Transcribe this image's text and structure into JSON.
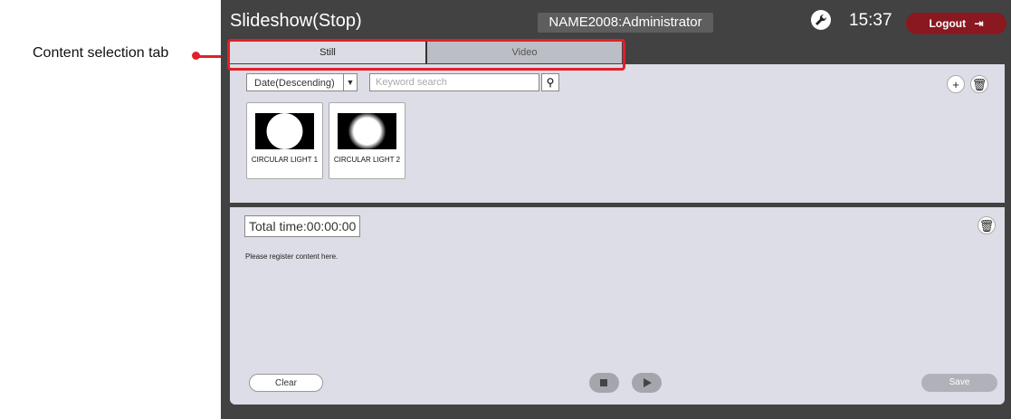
{
  "callout": {
    "label": "Content selection tab"
  },
  "header": {
    "title": "Slideshow(Stop)",
    "user": "NAME2008:Administrator",
    "time": "15:37",
    "logout_label": "Logout"
  },
  "tabs": [
    {
      "label": "Still",
      "selected": true
    },
    {
      "label": "Video",
      "selected": false
    }
  ],
  "content": {
    "sort_value": "Date(Descending)",
    "search_placeholder": "Keyword search",
    "items": [
      {
        "name": "CIRCULAR LIGHT 1"
      },
      {
        "name": "CIRCULAR LIGHT 2"
      }
    ]
  },
  "playlist": {
    "total_time": "Total time:00:00:00",
    "hint": "Please register content here.",
    "clear_label": "Clear",
    "save_label": "Save"
  },
  "colors": {
    "accent": "#8a1820",
    "highlight": "#e0202a",
    "panel": "#dcdde6",
    "chrome": "#424242"
  }
}
